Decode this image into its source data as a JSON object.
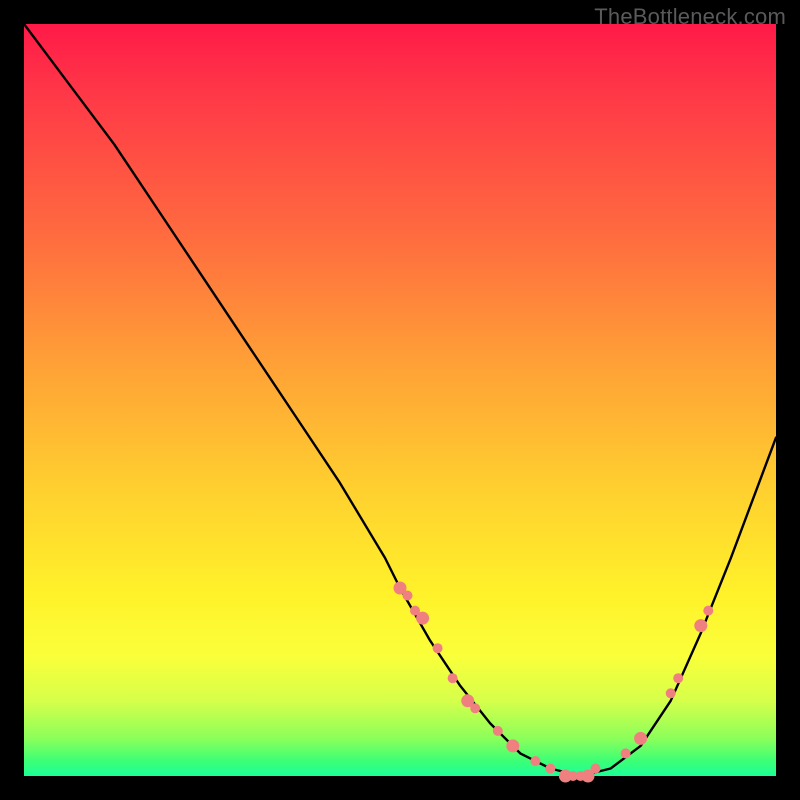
{
  "watermark": "TheBottleneck.com",
  "colors": {
    "background": "#000000",
    "gradient_top": "#ff1a48",
    "gradient_mid1": "#ff6b3f",
    "gradient_mid2": "#ffd02f",
    "gradient_mid3": "#fff22a",
    "gradient_bottom": "#1aff98",
    "curve_stroke": "#000000",
    "marker_fill": "#f08080",
    "watermark_text": "#5a5a5a"
  },
  "chart_data": {
    "type": "line",
    "title": "",
    "xlabel": "",
    "ylabel": "",
    "xlim": [
      0,
      100
    ],
    "ylim": [
      0,
      100
    ],
    "x": [
      0,
      6,
      12,
      18,
      24,
      30,
      36,
      42,
      48,
      50,
      54,
      58,
      62,
      66,
      70,
      74,
      78,
      82,
      86,
      90,
      94,
      100
    ],
    "values": [
      100,
      92,
      84,
      75,
      66,
      57,
      48,
      39,
      29,
      25,
      18,
      12,
      7,
      3,
      1,
      0,
      1,
      4,
      10,
      19,
      29,
      45
    ],
    "markers_x": [
      50,
      51,
      52,
      53,
      55,
      57,
      59,
      60,
      63,
      65,
      68,
      70,
      72,
      73,
      74,
      75,
      76,
      80,
      82,
      86,
      87,
      90,
      91
    ],
    "markers_y": [
      25,
      24,
      22,
      21,
      17,
      13,
      10,
      9,
      6,
      4,
      2,
      1,
      0,
      0,
      0,
      0,
      1,
      3,
      5,
      11,
      13,
      20,
      22
    ]
  }
}
